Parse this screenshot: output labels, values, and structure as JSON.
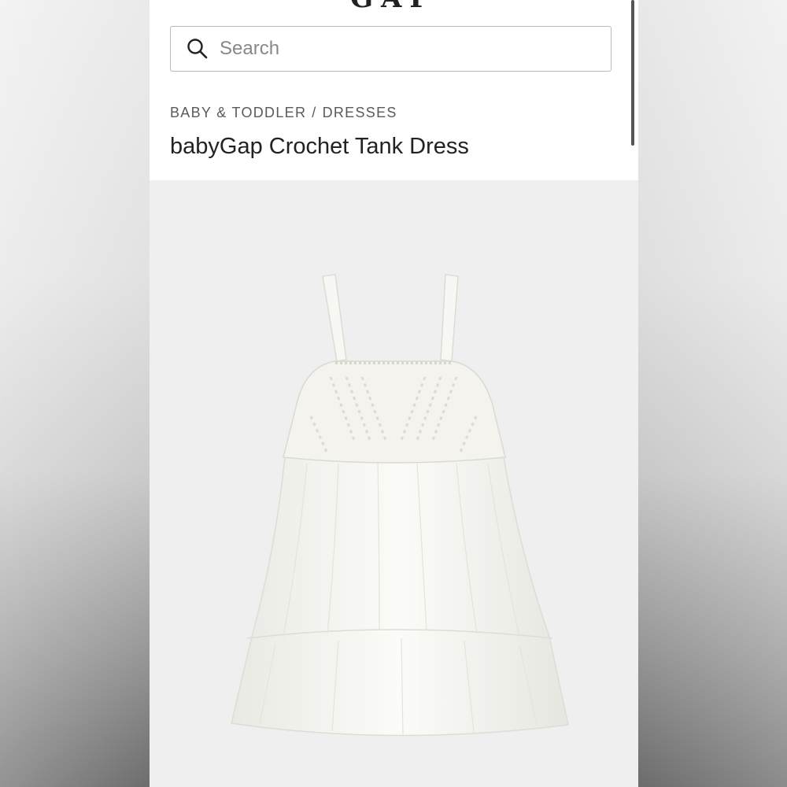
{
  "brand": {
    "logo_text": "GAP"
  },
  "search": {
    "placeholder": "Search"
  },
  "breadcrumb": {
    "items": [
      "BABY & TODDLER",
      "DRESSES"
    ],
    "separator": "/"
  },
  "product": {
    "title": "babyGap Crochet Tank Dress",
    "image_subject": "white crochet tank dress"
  },
  "colors": {
    "header_bg": "#ffffff",
    "image_bg": "#efefef",
    "text": "#222222"
  }
}
